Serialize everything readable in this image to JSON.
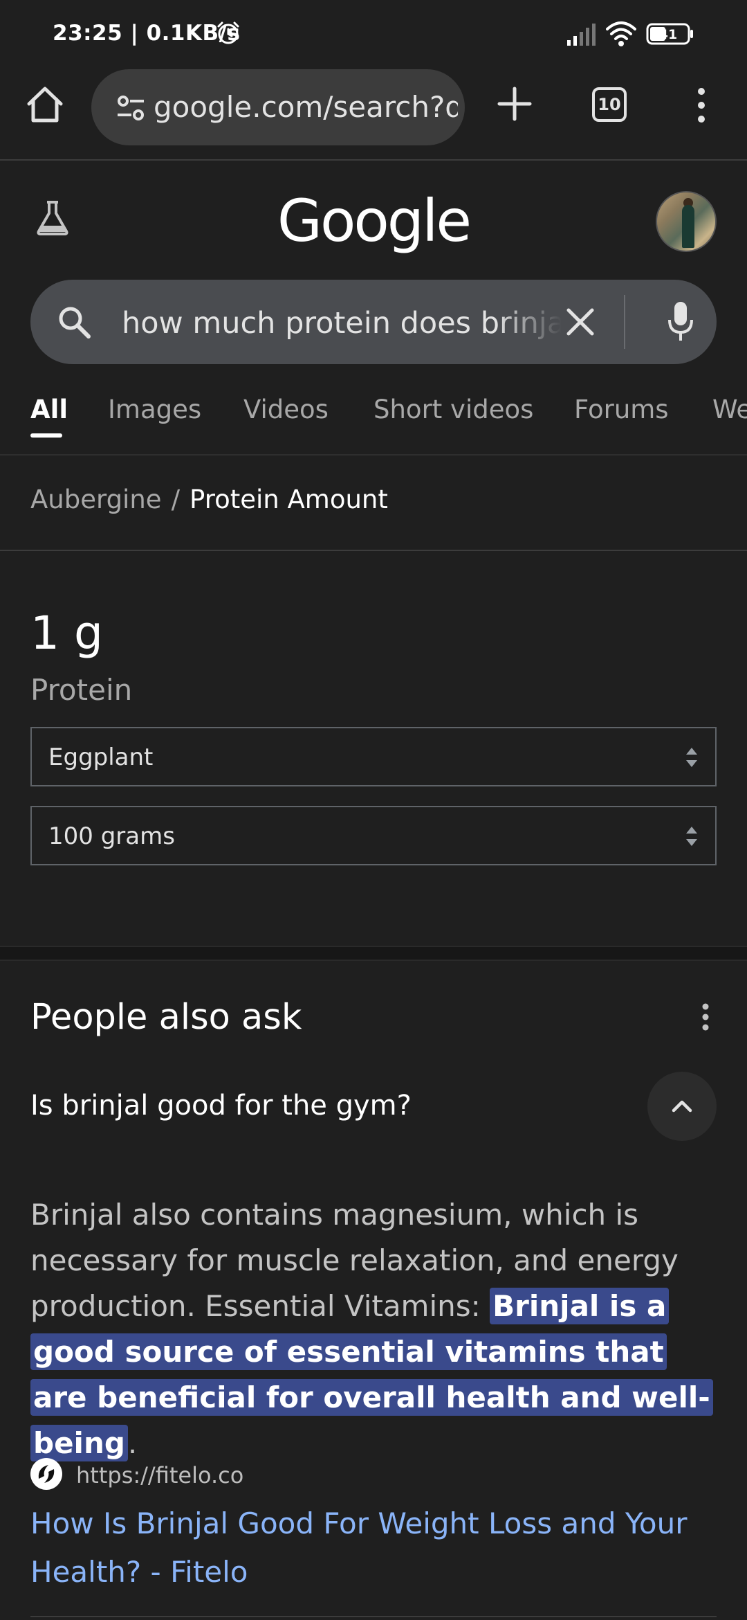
{
  "status_bar": {
    "time_speed": "23:25 | 0.1KB/s",
    "battery_level": "41"
  },
  "browser": {
    "url": "google.com/search?q",
    "tab_count": "10"
  },
  "google": {
    "logo_text": "Google"
  },
  "search": {
    "query": "how much protein does brinjal have"
  },
  "tabs": [
    {
      "label": "All",
      "active": true
    },
    {
      "label": "Images"
    },
    {
      "label": "Videos"
    },
    {
      "label": "Short videos"
    },
    {
      "label": "Forums"
    },
    {
      "label": "We"
    }
  ],
  "breadcrumb": {
    "parent": "Aubergine",
    "separator": "/",
    "current": "Protein Amount"
  },
  "nutrition": {
    "amount": "1 g",
    "nutrient": "Protein",
    "food_select": "Eggplant",
    "quantity_select": "100 grams"
  },
  "people_also_ask": {
    "title": "People also ask",
    "question": "Is brinjal good for the gym?",
    "answer_plain": "Brinjal also contains magnesium, which is necessary for muscle relaxation, and energy production. Essential Vitamins: ",
    "answer_highlight": "Brinjal is a good source of essential vitamins that are beneficial for overall health and well-being",
    "answer_end": ".",
    "source_url": "https://fitelo.co",
    "result_title": "How Is Brinjal Good For Weight Loss and Your Health? - Fitelo"
  },
  "colors": {
    "background": "#1f1f1f",
    "link": "#8ab4f8",
    "highlight": "#3a4a8c"
  }
}
